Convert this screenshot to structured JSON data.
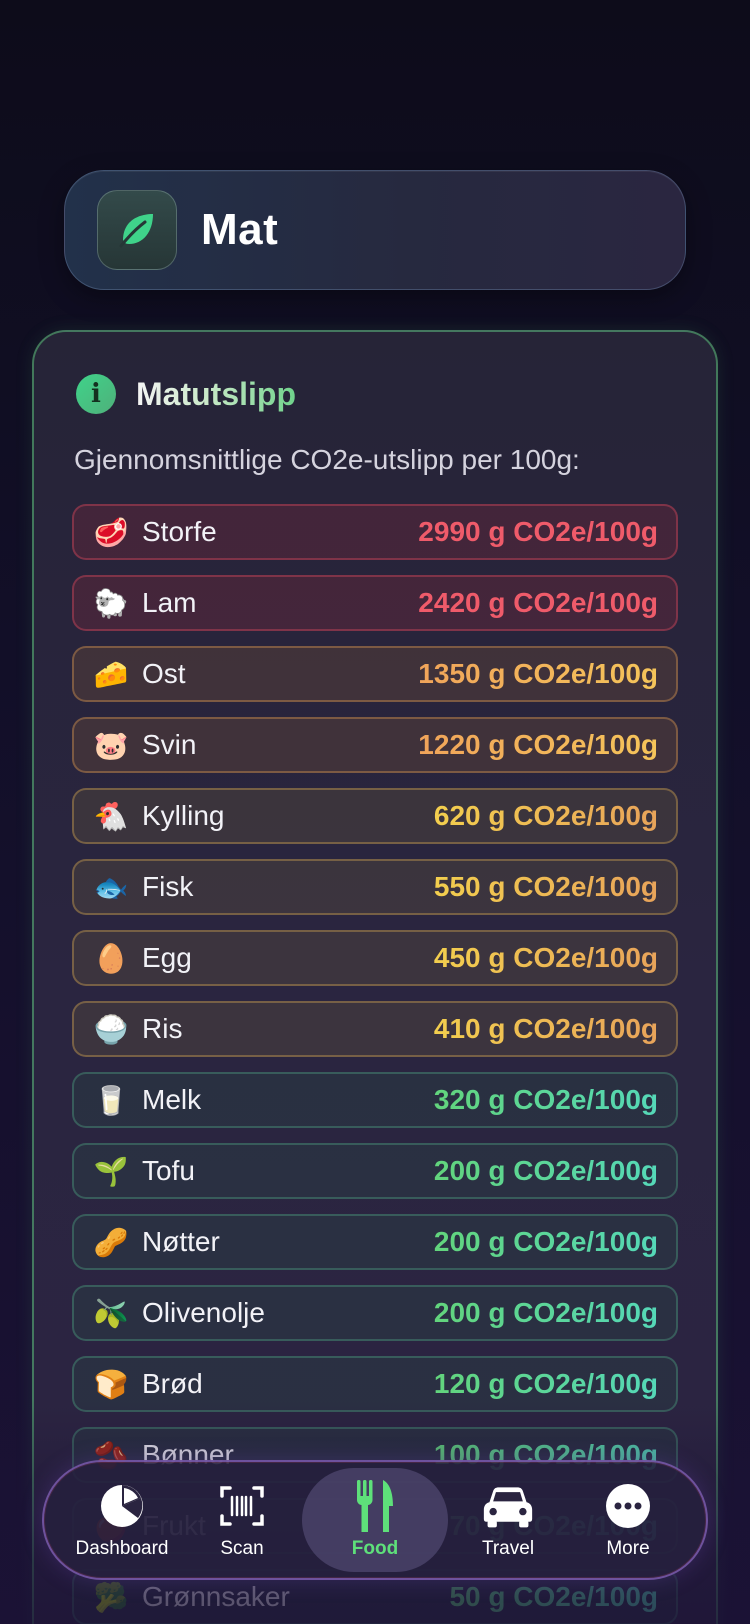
{
  "header": {
    "title": "Mat",
    "icon": "leaf-icon"
  },
  "section": {
    "title": "Matutslipp",
    "subtitle": "Gjennomsnittlige CO2e-utslipp per 100g:"
  },
  "items": [
    {
      "emoji": "🥩",
      "name": "Storfe",
      "value": "2990 g CO2e/100g",
      "level": "red"
    },
    {
      "emoji": "🐑",
      "name": "Lam",
      "value": "2420 g CO2e/100g",
      "level": "red"
    },
    {
      "emoji": "🧀",
      "name": "Ost",
      "value": "1350 g CO2e/100g",
      "level": "orange"
    },
    {
      "emoji": "🐷",
      "name": "Svin",
      "value": "1220 g CO2e/100g",
      "level": "orange"
    },
    {
      "emoji": "🐔",
      "name": "Kylling",
      "value": "620 g CO2e/100g",
      "level": "yellow"
    },
    {
      "emoji": "🐟",
      "name": "Fisk",
      "value": "550 g CO2e/100g",
      "level": "yellow"
    },
    {
      "emoji": "🥚",
      "name": "Egg",
      "value": "450 g CO2e/100g",
      "level": "yellow"
    },
    {
      "emoji": "🍚",
      "name": "Ris",
      "value": "410 g CO2e/100g",
      "level": "yellow"
    },
    {
      "emoji": "🥛",
      "name": "Melk",
      "value": "320 g CO2e/100g",
      "level": "green"
    },
    {
      "emoji": "🌱",
      "name": "Tofu",
      "value": "200 g CO2e/100g",
      "level": "green"
    },
    {
      "emoji": "🥜",
      "name": "Nøtter",
      "value": "200 g CO2e/100g",
      "level": "green"
    },
    {
      "emoji": "🫒",
      "name": "Olivenolje",
      "value": "200 g CO2e/100g",
      "level": "green"
    },
    {
      "emoji": "🍞",
      "name": "Brød",
      "value": "120 g CO2e/100g",
      "level": "green"
    },
    {
      "emoji": "🫘",
      "name": "Bønner",
      "value": "100 g CO2e/100g",
      "level": "green"
    },
    {
      "emoji": "🍎",
      "name": "Frukt",
      "value": "70 g CO2e/100g",
      "level": "green"
    },
    {
      "emoji": "🥦",
      "name": "Grønnsaker",
      "value": "50 g CO2e/100g",
      "level": "green"
    }
  ],
  "colors": {
    "red": "#ef5b6a",
    "orange": "#f0a45a",
    "yellow": "#f3cf4e",
    "green": "#62d47c",
    "active_tab": "#5ee07a"
  },
  "nav": {
    "active": "Food",
    "tabs": [
      {
        "label": "Dashboard",
        "icon": "pie-chart-icon"
      },
      {
        "label": "Scan",
        "icon": "barcode-scan-icon"
      },
      {
        "label": "Food",
        "icon": "fork-knife-icon"
      },
      {
        "label": "Travel",
        "icon": "car-icon"
      },
      {
        "label": "More",
        "icon": "ellipsis-icon"
      }
    ]
  }
}
